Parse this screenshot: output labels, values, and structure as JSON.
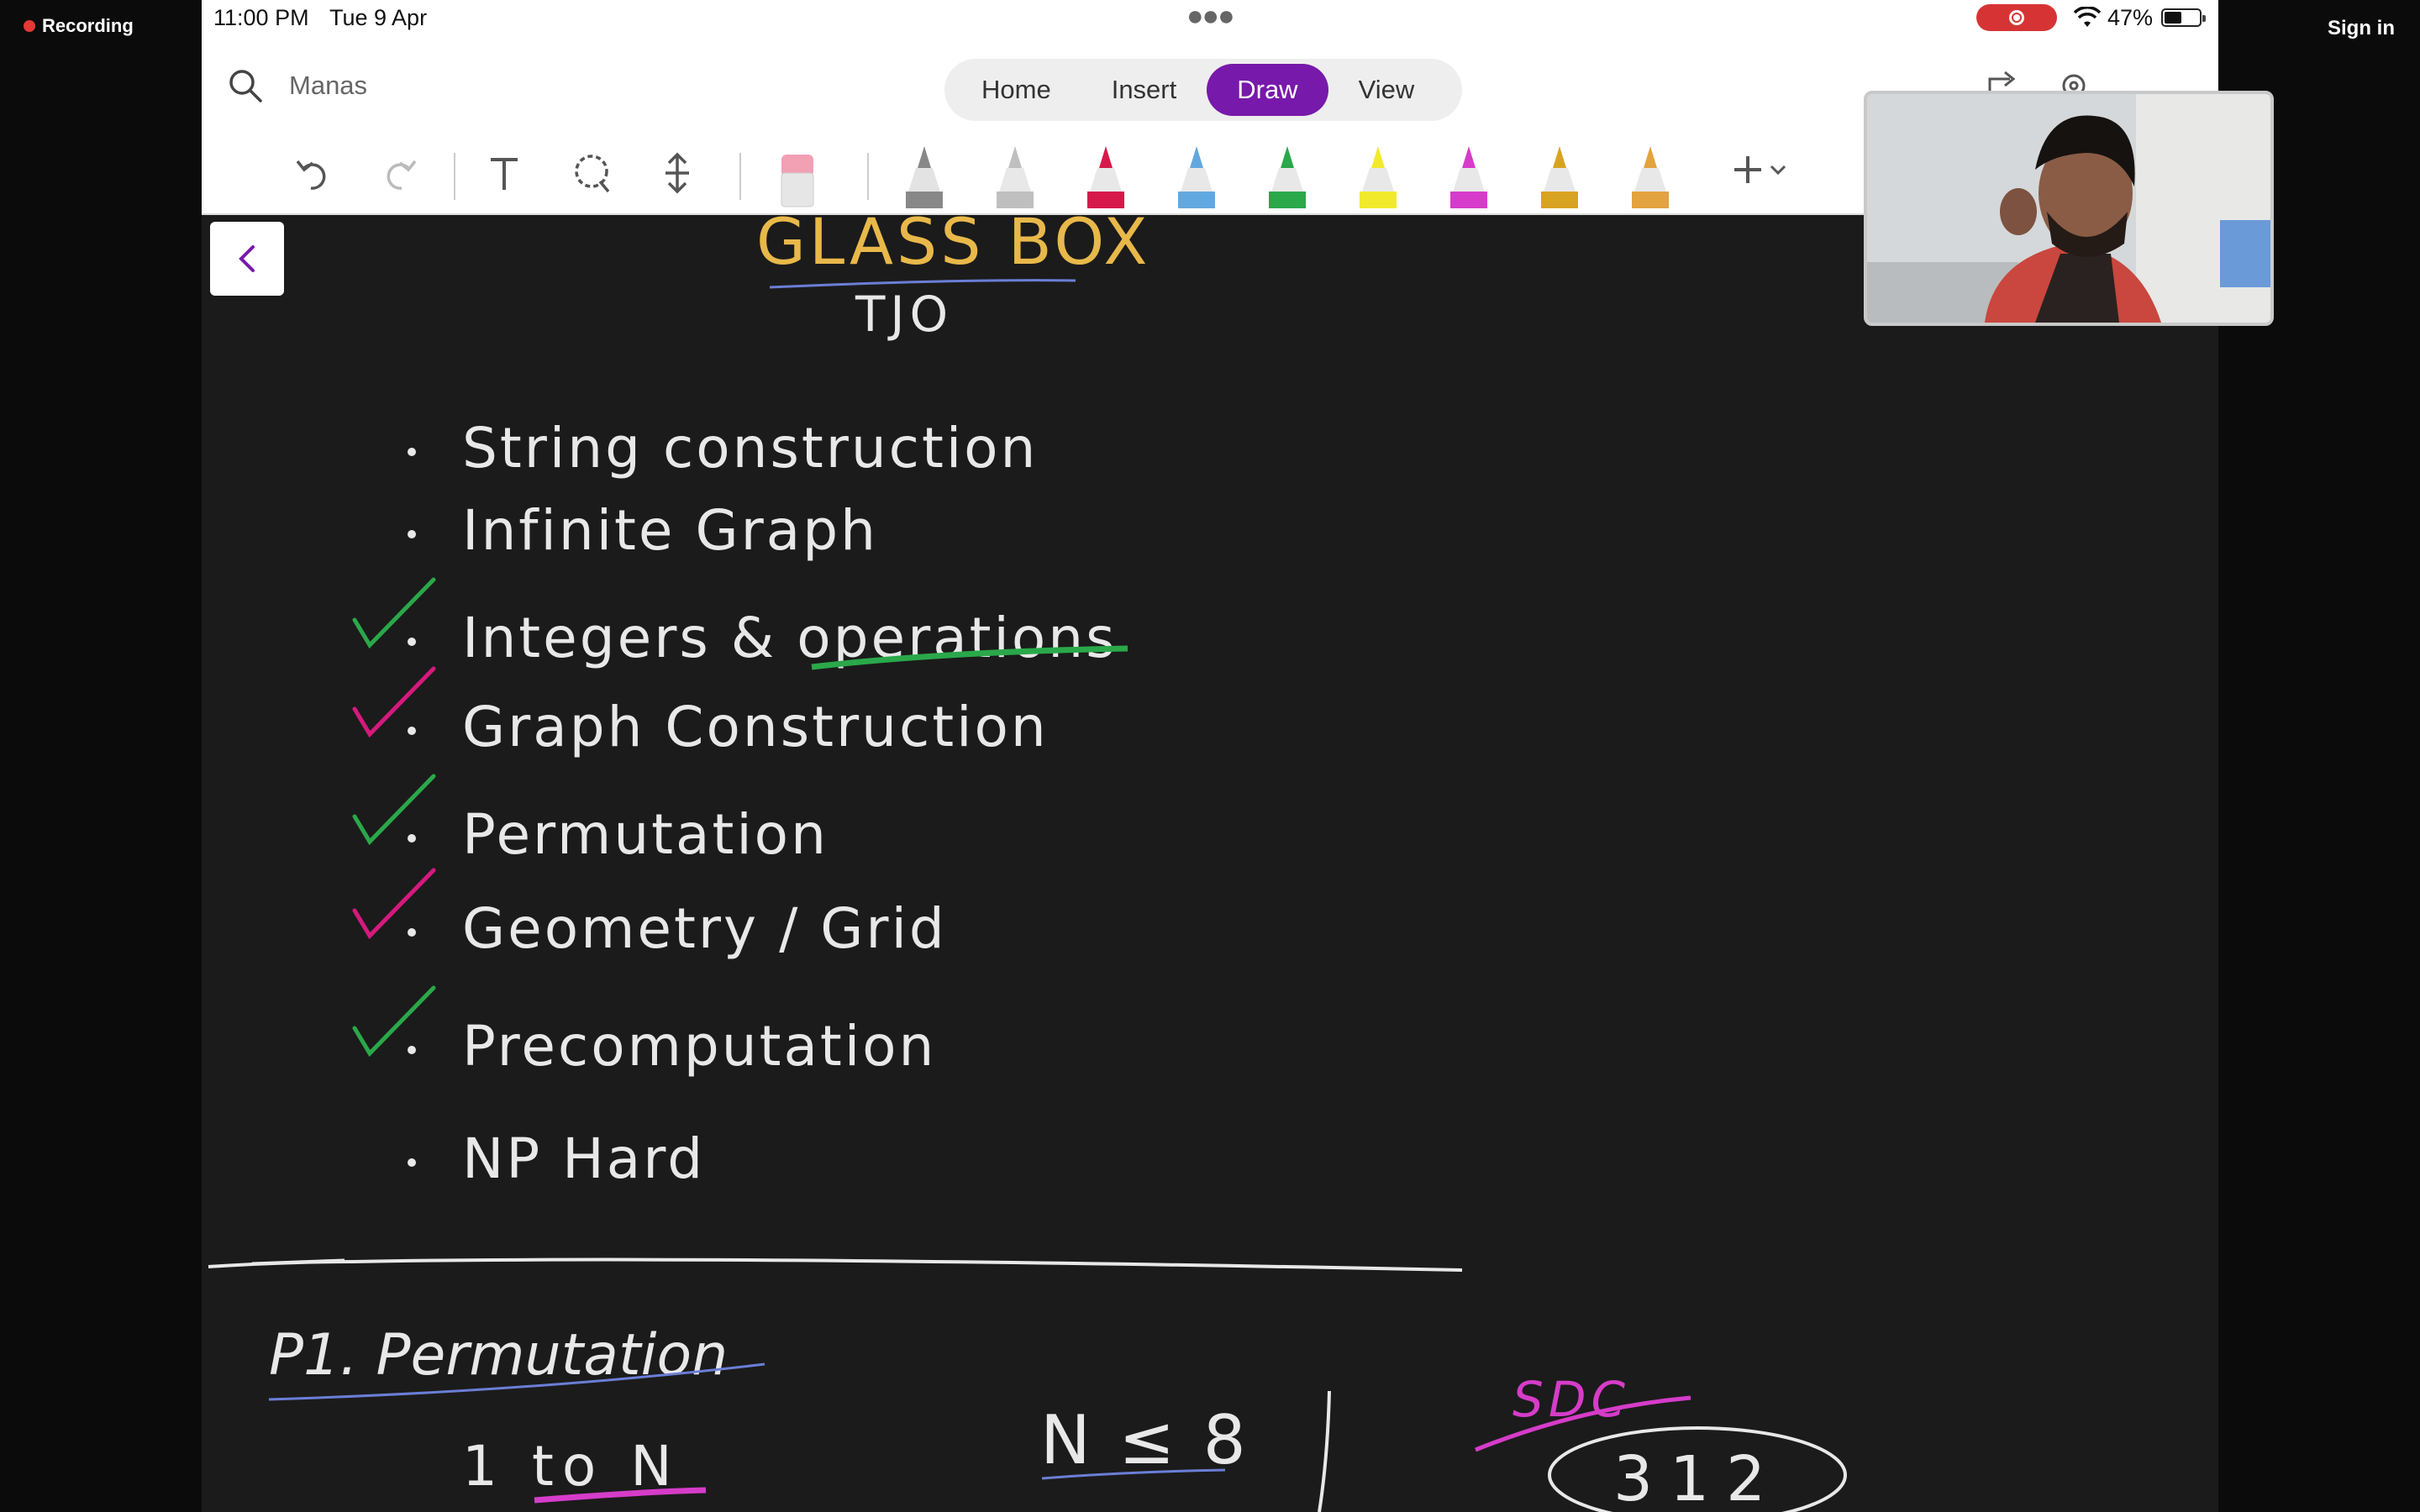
{
  "recording": {
    "label": "Recording"
  },
  "sign_in": "Sign in",
  "status": {
    "time": "11:00 PM",
    "date": "Tue 9 Apr",
    "battery": "47%"
  },
  "app": {
    "search_label": "Manas",
    "tabs": [
      {
        "label": "Home",
        "active": false
      },
      {
        "label": "Insert",
        "active": false
      },
      {
        "label": "Draw",
        "active": true
      },
      {
        "label": "View",
        "active": false
      }
    ]
  },
  "toolbar": {
    "tools": [
      "undo-icon",
      "redo-icon",
      "text-icon",
      "lasso-icon",
      "space-icon",
      "eraser-icon",
      "pencil-icon",
      "pen-icon",
      "pen-icon",
      "pen-icon",
      "pen-icon",
      "highlighter-icon",
      "pen-icon",
      "pen-icon",
      "pen-icon",
      "add-icon"
    ],
    "pen_colors": [
      "#888888",
      "#bfbfbf",
      "#d6194a",
      "#62a8e0",
      "#2aa84a",
      "#f1ea2c",
      "#d63cc9",
      "#d9a322",
      "#e3a33e"
    ]
  },
  "notes": {
    "title": "GLASS BOX",
    "subtitle": "TJO",
    "items": [
      {
        "text": "String construction",
        "mark": "none"
      },
      {
        "text": "Infinite Graph",
        "mark": "none"
      },
      {
        "text": "Integers & operations",
        "mark": "green"
      },
      {
        "text": "Graph Construction",
        "mark": "pink"
      },
      {
        "text": "Permutation",
        "mark": "green"
      },
      {
        "text": "Geometry / Grid",
        "mark": "pink"
      },
      {
        "text": "Precomputation",
        "mark": "green"
      },
      {
        "text": "NP Hard",
        "mark": "none"
      }
    ],
    "problem_heading": "P1. Permutation",
    "range_text": "1 to N",
    "constraint": "N ≤ 8",
    "crossed_word": "SDC",
    "circled_number": "312"
  },
  "colors": {
    "ink": "#e8e8e8",
    "title": "#e8b84a",
    "green": "#2aa84a",
    "pink": "#d6197e",
    "magenta": "#d63cc9",
    "accent": "#7719aa"
  }
}
